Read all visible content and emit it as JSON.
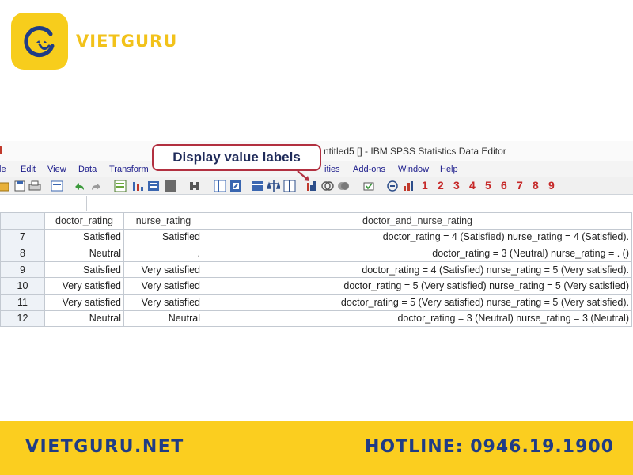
{
  "brand": {
    "logo_text": "VIETGURU",
    "logo_color": "#f2c21a"
  },
  "window": {
    "title": "ntitled5 [] - IBM SPSS Statistics Data Editor"
  },
  "menu": {
    "items": [
      "le",
      "Edit",
      "View",
      "Data",
      "Transform",
      "ities",
      "Add-ons",
      "Window",
      "Help"
    ]
  },
  "toolbar": {
    "numbers": [
      "1",
      "2",
      "3",
      "4",
      "5",
      "6",
      "7",
      "8",
      "9"
    ]
  },
  "callout": {
    "label": "Display value labels"
  },
  "grid": {
    "columns": [
      "doctor_rating",
      "nurse_rating",
      "doctor_and_nurse_rating"
    ],
    "rows": [
      {
        "n": "7",
        "doctor": "Satisfied",
        "nurse": "Satisfied",
        "combo": "doctor_rating = 4 (Satisfied) nurse_rating = 4 (Satisfied)."
      },
      {
        "n": "8",
        "doctor": "Neutral",
        "nurse": ".",
        "combo": "doctor_rating = 3 (Neutral) nurse_rating = . ()"
      },
      {
        "n": "9",
        "doctor": "Satisfied",
        "nurse": "Very satisfied",
        "combo": "doctor_rating = 4 (Satisfied) nurse_rating = 5 (Very satisfied)."
      },
      {
        "n": "10",
        "doctor": "Very satisfied",
        "nurse": "Very satisfied",
        "combo": "doctor_rating = 5 (Very satisfied) nurse_rating = 5 (Very satisfied)"
      },
      {
        "n": "11",
        "doctor": "Very satisfied",
        "nurse": "Very satisfied",
        "combo": "doctor_rating = 5 (Very satisfied) nurse_rating = 5 (Very satisfied)."
      },
      {
        "n": "12",
        "doctor": "Neutral",
        "nurse": "Neutral",
        "combo": "doctor_rating = 3 (Neutral) nurse_rating = 3 (Neutral)"
      }
    ]
  },
  "footer": {
    "website": "VIETGURU.NET",
    "hotline": "HOTLINE: 0946.19.1900",
    "bg_color": "#fbce1f",
    "text_color": "#1f3c86"
  }
}
